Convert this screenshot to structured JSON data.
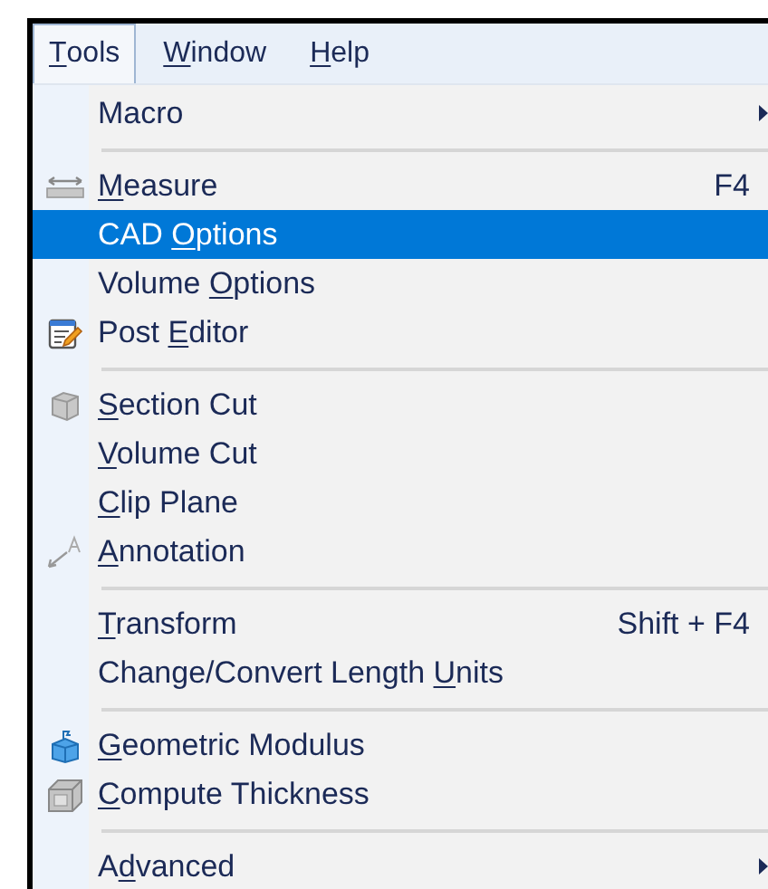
{
  "menu_bar": [
    {
      "key": "T",
      "post": "ools",
      "selected": true
    },
    {
      "key": "W",
      "post": "indow",
      "selected": false
    },
    {
      "key": "H",
      "post": "elp",
      "selected": false
    }
  ],
  "menu": [
    {
      "kind": "item",
      "pre": "Macro",
      "submenu": true,
      "selected": false
    },
    {
      "kind": "separator"
    },
    {
      "kind": "item",
      "key": "M",
      "post": "easure",
      "shortcut": "F4",
      "selected": false
    },
    {
      "kind": "item",
      "pre": "CAD ",
      "key": "O",
      "post": "ptions",
      "selected": true
    },
    {
      "kind": "item",
      "pre": "Volume ",
      "key": "O",
      "post": "ptions",
      "selected": false
    },
    {
      "kind": "item",
      "pre": "Post ",
      "key": "E",
      "post": "ditor",
      "selected": false
    },
    {
      "kind": "separator"
    },
    {
      "kind": "item",
      "key": "S",
      "post": "ection Cut",
      "selected": false
    },
    {
      "kind": "item",
      "key": "V",
      "post": "olume Cut",
      "selected": false
    },
    {
      "kind": "item",
      "key": "C",
      "post": "lip Plane",
      "selected": false
    },
    {
      "kind": "item",
      "key": "A",
      "post": "nnotation",
      "selected": false
    },
    {
      "kind": "separator"
    },
    {
      "kind": "item",
      "key": "T",
      "post": "ransform",
      "shortcut": "Shift + F4",
      "selected": false
    },
    {
      "kind": "item",
      "pre": "Change/Convert Length ",
      "key": "U",
      "post": "nits",
      "selected": false
    },
    {
      "kind": "separator"
    },
    {
      "kind": "item",
      "key": "G",
      "post": "eometric Modulus",
      "selected": false
    },
    {
      "kind": "item",
      "key": "C",
      "post": "ompute Thickness",
      "selected": false
    },
    {
      "kind": "separator"
    },
    {
      "kind": "item",
      "pre": "A",
      "key": "d",
      "post": "vanced",
      "submenu": true,
      "selected": false
    }
  ]
}
